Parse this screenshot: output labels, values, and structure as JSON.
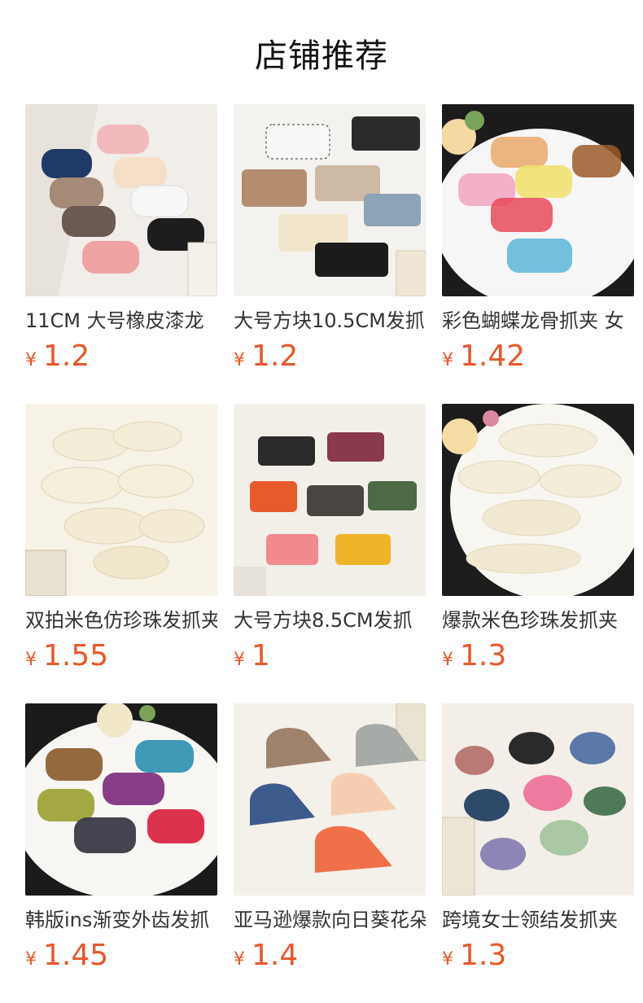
{
  "page": {
    "title": "店铺推荐"
  },
  "products": [
    {
      "name": "11CM 大号橡皮漆龙",
      "currency": "¥",
      "price": "1.2"
    },
    {
      "name": "大号方块10.5CM发抓",
      "currency": "¥",
      "price": "1.2"
    },
    {
      "name": "彩色蝴蝶龙骨抓夹 女",
      "currency": "¥",
      "price": "1.42"
    },
    {
      "name": "双拍米色仿珍珠发抓夹",
      "currency": "¥",
      "price": "1.55"
    },
    {
      "name": "大号方块8.5CM发抓",
      "currency": "¥",
      "price": "1"
    },
    {
      "name": "爆款米色珍珠发抓夹",
      "currency": "¥",
      "price": "1.3"
    },
    {
      "name": "韩版ins渐变外齿发抓",
      "currency": "¥",
      "price": "1.45"
    },
    {
      "name": "亚马逊爆款向日葵花朵",
      "currency": "¥",
      "price": "1.4"
    },
    {
      "name": "跨境女士领结发抓夹",
      "currency": "¥",
      "price": "1.3"
    }
  ],
  "theme": {
    "price_color": "#e8572a",
    "background": "#ffffff"
  }
}
